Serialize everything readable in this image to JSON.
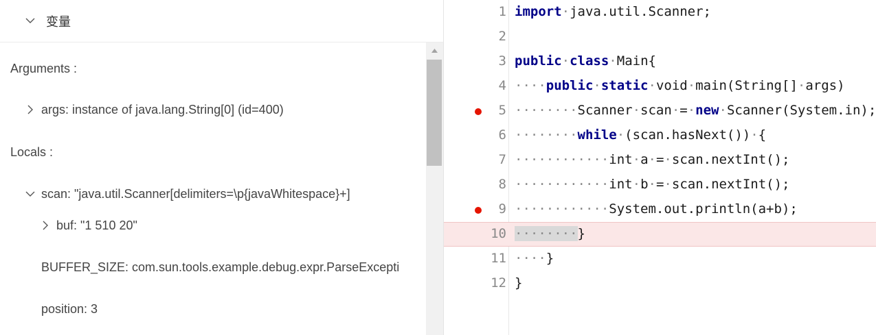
{
  "variables_panel": {
    "title": "变量",
    "arguments_label": "Arguments :",
    "locals_label": "Locals :",
    "args_item": "args: instance of java.lang.String[0] (id=400)",
    "scan_item": "scan: \"java.util.Scanner[delimiters=\\p{javaWhitespace}+]",
    "buf_item": "buf: \"1 510 20\"",
    "buffer_size_item": "BUFFER_SIZE: com.sun.tools.example.debug.expr.ParseException",
    "position_item": "position: 3"
  },
  "editor": {
    "lines": [
      {
        "number": "1",
        "breakpoint": false,
        "current": false
      },
      {
        "number": "2",
        "breakpoint": false,
        "current": false
      },
      {
        "number": "3",
        "breakpoint": false,
        "current": false
      },
      {
        "number": "4",
        "breakpoint": false,
        "current": false
      },
      {
        "number": "5",
        "breakpoint": true,
        "current": false
      },
      {
        "number": "6",
        "breakpoint": false,
        "current": false
      },
      {
        "number": "7",
        "breakpoint": false,
        "current": false
      },
      {
        "number": "8",
        "breakpoint": false,
        "current": false
      },
      {
        "number": "9",
        "breakpoint": true,
        "current": false
      },
      {
        "number": "10",
        "breakpoint": false,
        "current": true
      },
      {
        "number": "11",
        "breakpoint": false,
        "current": false
      },
      {
        "number": "12",
        "breakpoint": false,
        "current": false
      }
    ],
    "code": {
      "l1_kw": "import",
      "l1_rest": "java.util.Scanner;",
      "l3_kw1": "public",
      "l3_kw2": "class",
      "l3_rest": "Main{",
      "l4_kw1": "public",
      "l4_kw2": "static",
      "l4_t1": "void",
      "l4_t2": "main(String[]",
      "l4_t3": "args)",
      "l5_t1": "Scanner",
      "l5_t2": "scan",
      "l5_t3": "=",
      "l5_kw": "new",
      "l5_t4": "Scanner(System.in);",
      "l6_kw": "while",
      "l6_t1": "(scan.hasNext())",
      "l6_t2": "{",
      "l7_t1": "int",
      "l7_t2": "a",
      "l7_t3": "=",
      "l7_t4": "scan.nextInt();",
      "l8_t1": "int",
      "l8_t2": "b",
      "l8_t3": "=",
      "l8_t4": "scan.nextInt();",
      "l9_t1": "System.out.println(a+b);",
      "l10_t1": "}",
      "l11_t1": "}",
      "l12_t1": "}"
    }
  }
}
